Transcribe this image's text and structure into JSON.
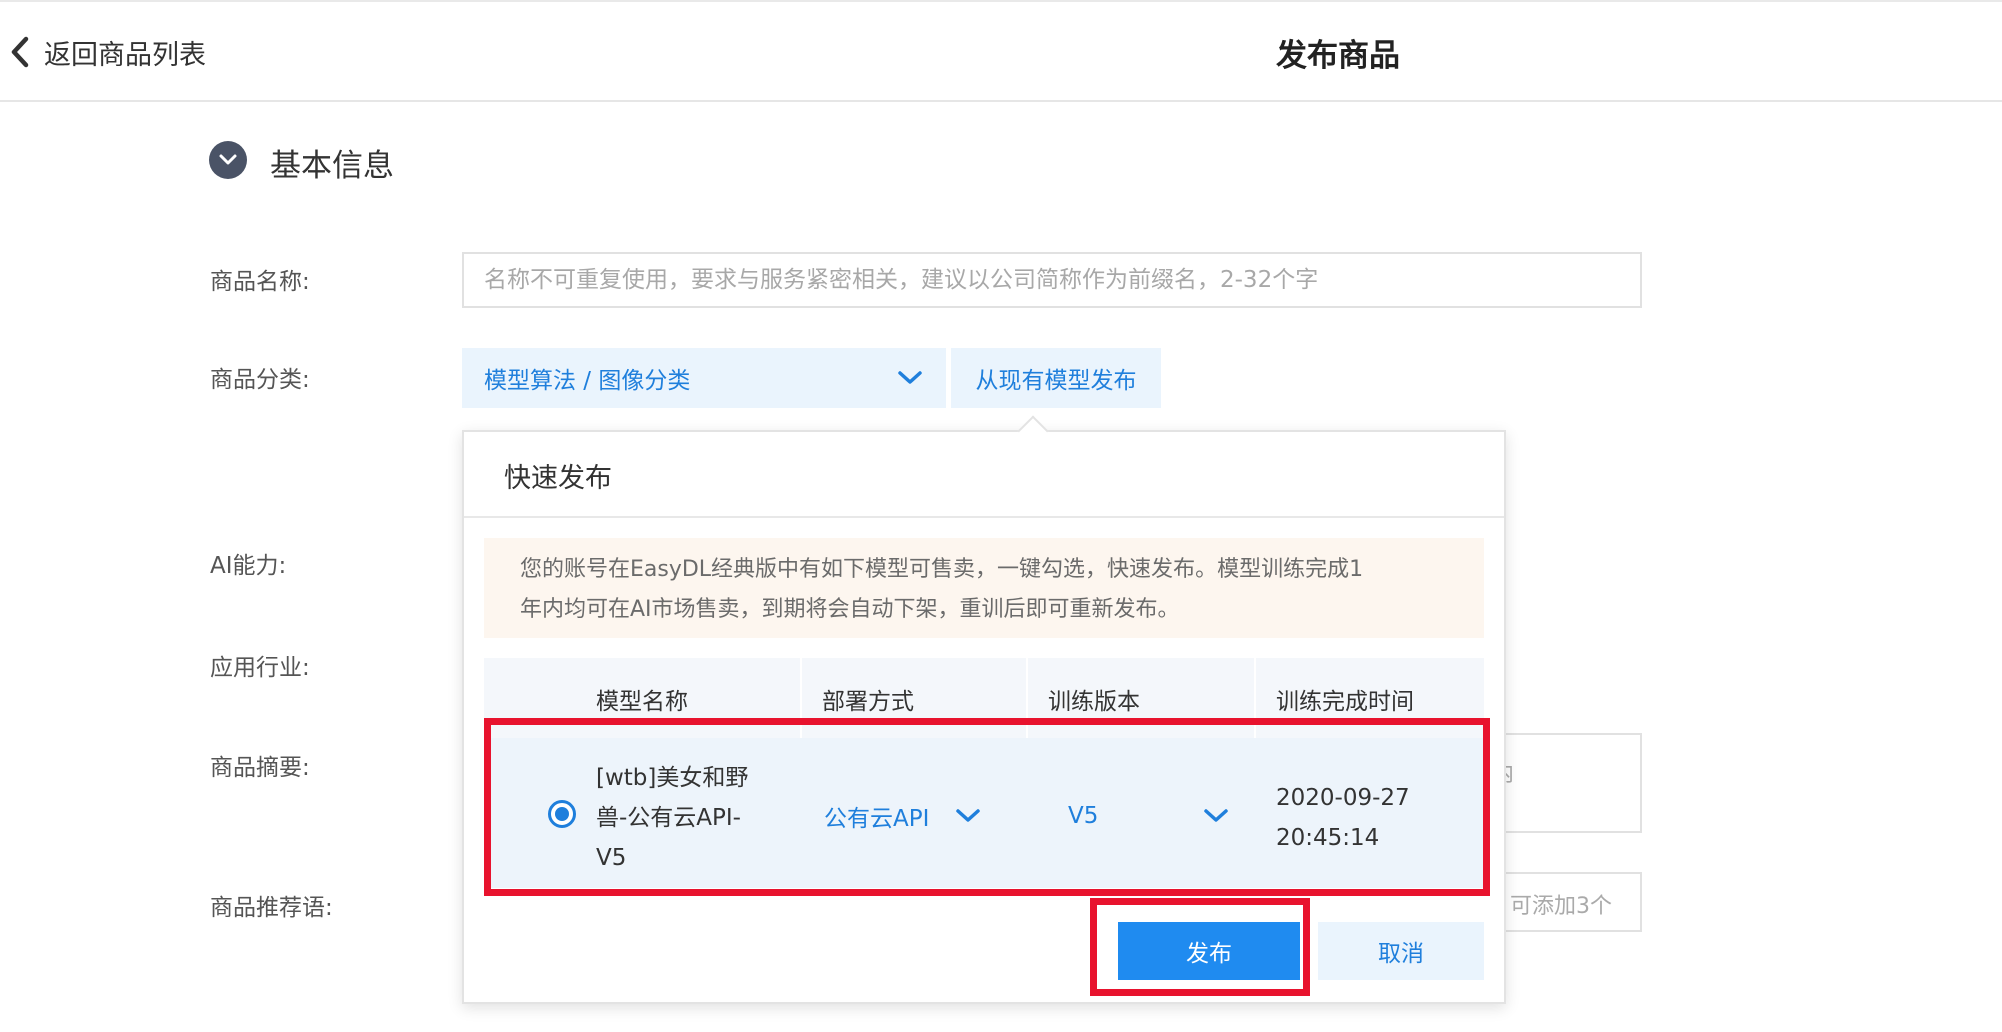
{
  "header": {
    "back_label": "返回商品列表",
    "title": "发布商品"
  },
  "section": {
    "title": "基本信息"
  },
  "form": {
    "name_label": "商品名称:",
    "name_placeholder": "名称不可重复使用，要求与服务紧密相关，建议以公司简称作为前缀名，2-32个字",
    "category_label": "商品分类:",
    "category_value": "模型算法 / 图像分类",
    "from_model_button": "从现有模型发布",
    "ai_label": "AI能力:",
    "industry_label": "应用行业:",
    "summary_label": "商品摘要:",
    "summary_fragment": "内",
    "recommend_label": "商品推荐语:",
    "recommend_fragment": "可添加3个"
  },
  "popover": {
    "title": "快速发布",
    "notice_line1": "您的账号在EasyDL经典版中有如下模型可售卖，一键勾选，快速发布。模型训练完成1",
    "notice_line2": "年内均可在AI市场售卖，到期将会自动下架，重训后即可重新发布。",
    "columns": [
      "模型名称",
      "部署方式",
      "训练版本",
      "训练完成时间"
    ],
    "row": {
      "selected": true,
      "model_name_line1": "[wtb]美女和野",
      "model_name_line2": "兽-公有云API-",
      "model_name_line3": "V5",
      "deploy": "公有云API",
      "version": "V5",
      "time_date": "2020-09-27",
      "time_clock": "20:45:14"
    },
    "publish_button": "发布",
    "cancel_button": "取消"
  },
  "colors": {
    "accent": "#1f8bf0",
    "link": "#1f7fdc",
    "highlight": "#e8132e",
    "notice_bg": "#fdf6ef"
  }
}
